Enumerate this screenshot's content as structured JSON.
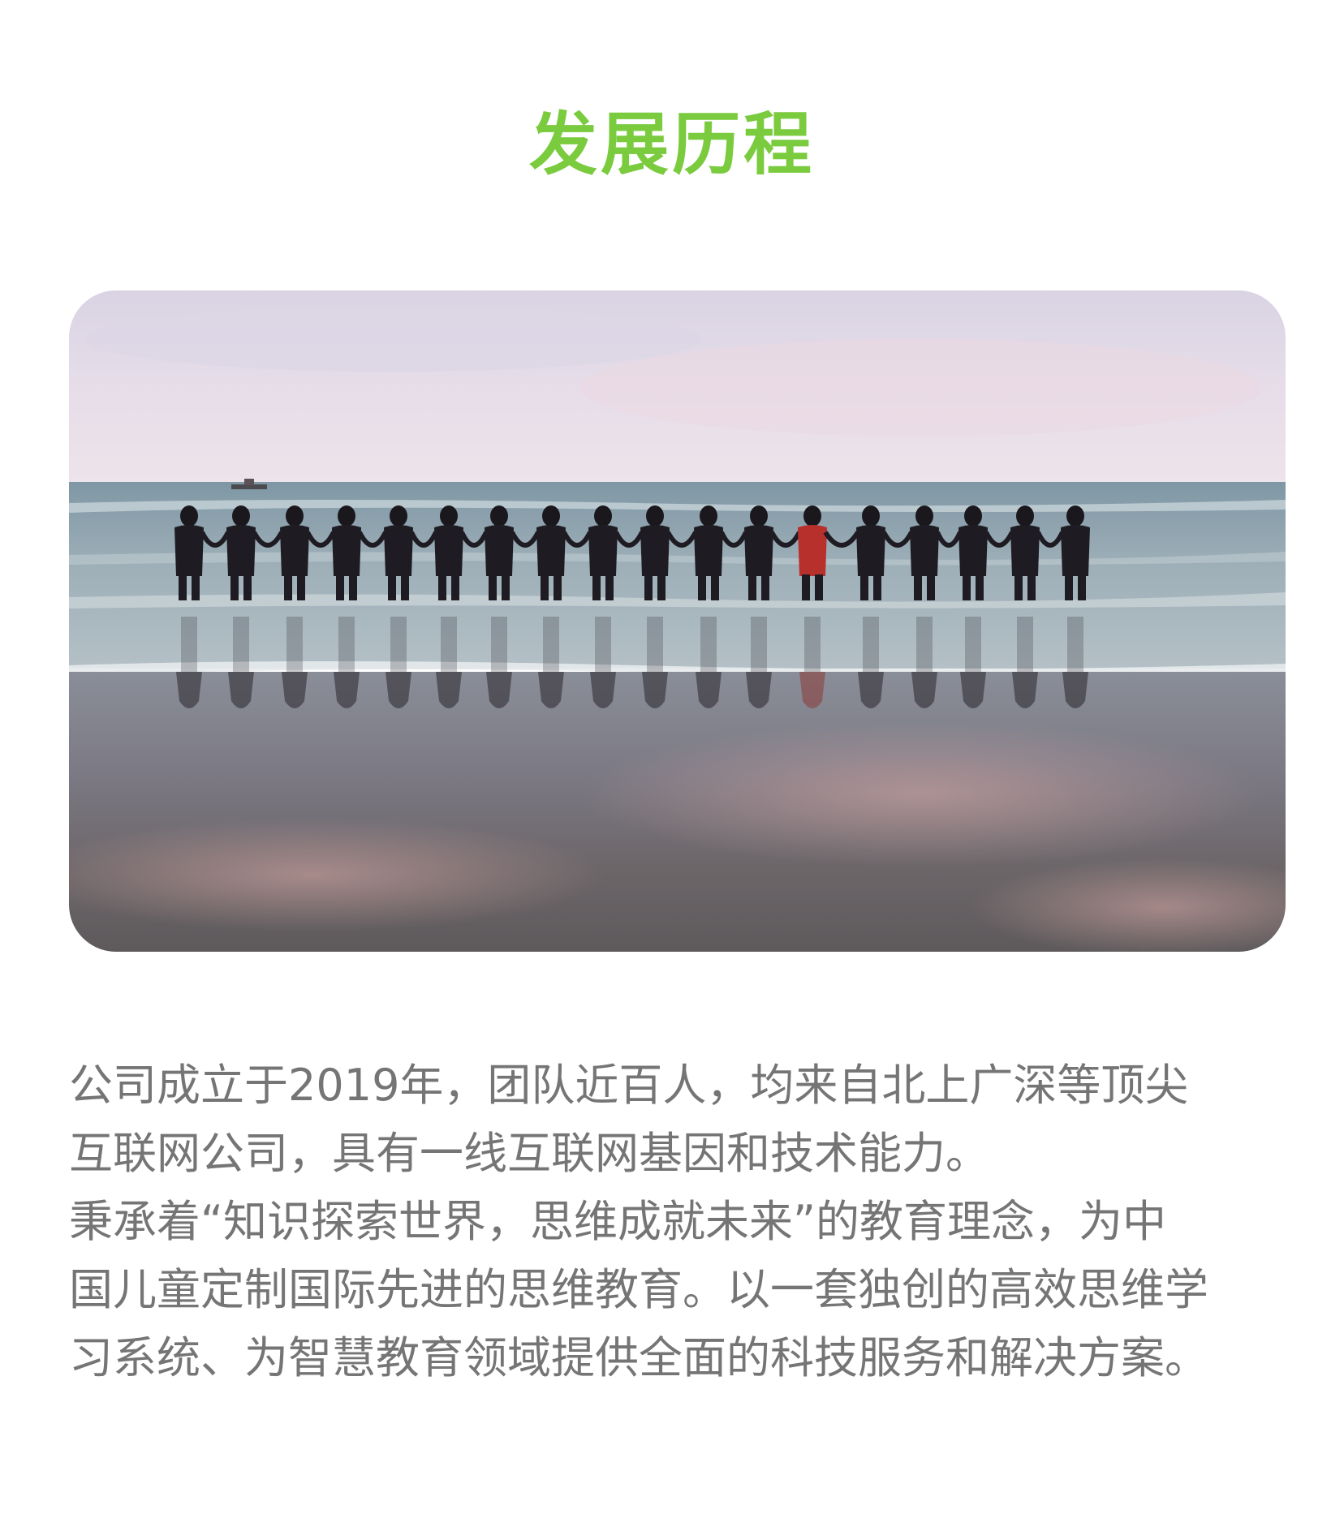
{
  "page": {
    "title": "发展历程",
    "title_color": "#7ACB3E",
    "text_color": "#757575"
  },
  "photo": {
    "subject": "group of people holding hands at the shoreline of a beach at dusk",
    "sky_color": "#E4DCE8",
    "sea_color": "#8EA3AE",
    "sand_color": "#6F6B6C"
  },
  "intro": {
    "paragraph_1": "公司成立于2019年，团队近百人，均来自北上广深等顶尖\n互联网公司，具有一线互联网基因和技术能力。",
    "paragraph_2": "秉承着“知识探索世界，思维成就未来”的教育理念，为中\n国儿童定制国际先进的思维教育。以一套独创的高效思维学\n习系统、为智慧教育领域提供全面的科技服务和解决方案。"
  }
}
